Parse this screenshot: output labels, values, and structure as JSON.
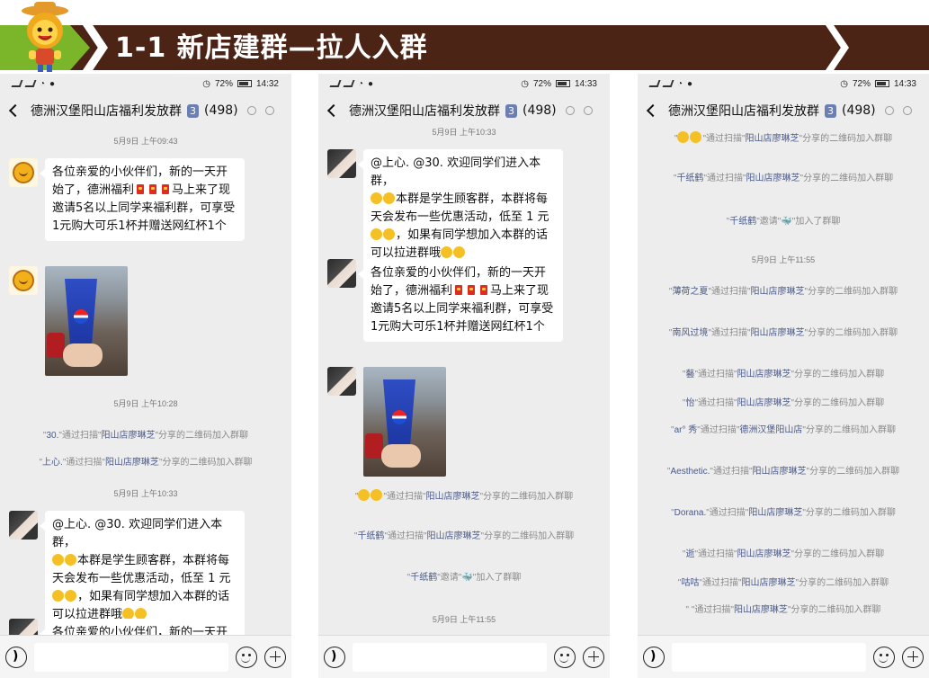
{
  "banner": {
    "title": "1-1  新店建群—拉人入群"
  },
  "status": {
    "battery": "72%",
    "time": "14:32",
    "time2": "14:33"
  },
  "group": {
    "name": "德洲汉堡阳山店福利发放群",
    "badge": "3",
    "count": "(498)"
  },
  "messages": {
    "welcome": "各位亲爱的小伙伴们，新的一天开始了，德洲福利",
    "welcome_tail": "马上来了现邀请5名以上同学来福利群，可享受1元购大可乐1杯并赠送网红杯1个",
    "notice_head": "@上心. @30. 欢迎同学们进入本群，",
    "notice_mid": "本群是学生顾客群，本群将每天会发布一些优惠活动，低至 1 元",
    "notice_tail": "，如果有同学想加入本群的话可以拉进群哦"
  },
  "times": {
    "t0943": "5月9日 上午09:43",
    "t1028": "5月9日 上午10:28",
    "t1033": "5月9日 上午10:33",
    "t1155": "5月9日 上午11:55"
  },
  "system": {
    "scan_mid": "\"通过扫描\"",
    "scan_tail": "\"分享的二维码加入群聊",
    "invite_mid": "\"邀请\"",
    "invite_tail": "\"加入了群聊",
    "sharer1": "阳山店廖琳芝",
    "sharer2": "德洲汉堡阳山店",
    "users": [
      "30.",
      "上心.",
      "千纸鹤",
      "薄荷之夏",
      "南风过境",
      "藝",
      "怡",
      "ar° 秀",
      "Aesthetic.",
      "Dorana.",
      "逝",
      "咕咕"
    ]
  }
}
